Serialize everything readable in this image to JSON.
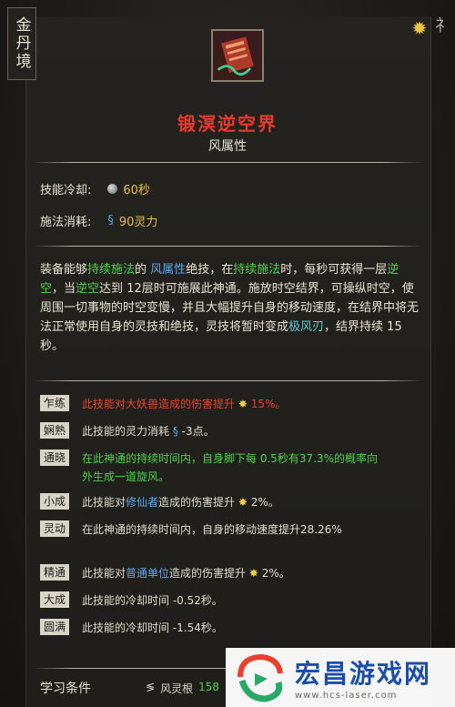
{
  "realm": "金丹境",
  "skill": {
    "name": "锻溟逆空界",
    "attribute": "风属性",
    "cooldown_label": "技能冷却:",
    "cooldown_value": "60秒",
    "cost_label": "施法消耗:",
    "cost_value": "90灵力"
  },
  "description": [
    {
      "t": "装备能够",
      "c": ""
    },
    {
      "t": "持续施法",
      "c": "green"
    },
    {
      "t": "的 ",
      "c": ""
    },
    {
      "t": "风属性",
      "c": "blue"
    },
    {
      "t": "绝技，在",
      "c": ""
    },
    {
      "t": "持续施法",
      "c": "green"
    },
    {
      "t": "时，每秒可获得一层",
      "c": ""
    },
    {
      "t": "逆空",
      "c": "green"
    },
    {
      "t": "，当",
      "c": ""
    },
    {
      "t": "逆空",
      "c": "green"
    },
    {
      "t": "达到 ",
      "c": ""
    },
    {
      "t": "12层时可施展此神通。施放时空结界，可操纵时空，使周围一切事物的时空变慢，并且大幅提升自身的移动速度，在结界中将无法正常使用自身的灵技和绝技，灵技将暂时变成",
      "c": ""
    },
    {
      "t": "极风刃",
      "c": "cyan"
    },
    {
      "t": "，结界持续 ",
      "c": ""
    },
    {
      "t": "15秒。",
      "c": ""
    }
  ],
  "tiers": [
    {
      "badge": "乍练",
      "parts": [
        {
          "t": "此技能对大妖兽造成的伤害提升 ",
          "c": "red"
        },
        {
          "t": "✸",
          "c": "sparkle"
        },
        {
          "t": " 15%。",
          "c": "red"
        }
      ]
    },
    {
      "badge": "娴熟",
      "parts": [
        {
          "t": "此技能的灵力消耗 ",
          "c": ""
        },
        {
          "t": "§",
          "c": "blue"
        },
        {
          "t": " -3点。",
          "c": ""
        }
      ]
    },
    {
      "badge": "通晓",
      "parts": [
        {
          "t": "在此神通的持续时间内，自身脚下每 ",
          "c": "green"
        },
        {
          "t": "0.5秒有",
          "c": "green"
        },
        {
          "t": "37.3%的概率向外生成一道旋风。",
          "c": "green"
        }
      ]
    },
    {
      "badge": "小成",
      "parts": [
        {
          "t": "此技能对",
          "c": ""
        },
        {
          "t": "修仙者",
          "c": "blue"
        },
        {
          "t": "造成的伤害提升 ",
          "c": ""
        },
        {
          "t": "✸",
          "c": "sparkle"
        },
        {
          "t": " 2%。",
          "c": ""
        }
      ]
    },
    {
      "badge": "灵动",
      "parts": [
        {
          "t": "在此神通的持续时间内，自身的移动速度提升",
          "c": ""
        },
        {
          "t": "28.26%",
          "c": ""
        }
      ]
    },
    {
      "badge": "精通",
      "parts": [
        {
          "t": "此技能对",
          "c": ""
        },
        {
          "t": "普通单位",
          "c": "blue"
        },
        {
          "t": "造成的伤害提升 ",
          "c": ""
        },
        {
          "t": "✸",
          "c": "sparkle"
        },
        {
          "t": " 2%。",
          "c": ""
        }
      ]
    },
    {
      "badge": "大成",
      "parts": [
        {
          "t": "此技能的冷却时间 ",
          "c": ""
        },
        {
          "t": "-0.52秒。",
          "c": ""
        }
      ]
    },
    {
      "badge": "圆满",
      "parts": [
        {
          "t": "此技能的冷却时间 ",
          "c": ""
        },
        {
          "t": "-1.54秒。",
          "c": ""
        }
      ]
    }
  ],
  "footer": {
    "label": "学习条件",
    "requirement": "风灵根",
    "value": "158"
  },
  "watermark": {
    "name": "宏昌游戏网",
    "url": "www.hcs-laser.com"
  }
}
